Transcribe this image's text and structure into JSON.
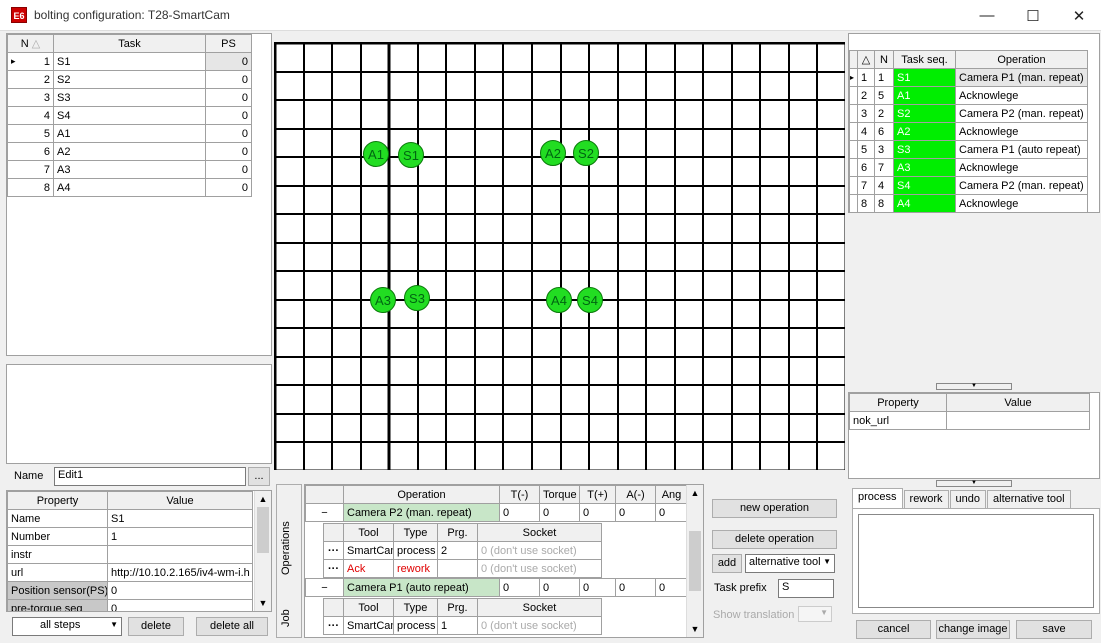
{
  "window": {
    "title": "bolting configuration:  T28-SmartCam",
    "icon_text": "E6"
  },
  "colors": {
    "green": "#00ee00",
    "dot": "#22dd22",
    "grid": "#000000"
  },
  "task_table": {
    "headers": [
      "N",
      "Task",
      "PS"
    ],
    "rows": [
      {
        "n": "1",
        "task": "S1",
        "ps": "0"
      },
      {
        "n": "2",
        "task": "S2",
        "ps": "0"
      },
      {
        "n": "3",
        "task": "S3",
        "ps": "0"
      },
      {
        "n": "4",
        "task": "S4",
        "ps": "0"
      },
      {
        "n": "5",
        "task": "A1",
        "ps": "0"
      },
      {
        "n": "6",
        "task": "A2",
        "ps": "0"
      },
      {
        "n": "7",
        "task": "A3",
        "ps": "0"
      },
      {
        "n": "8",
        "task": "A4",
        "ps": "0"
      }
    ]
  },
  "name_field": {
    "label": "Name",
    "value": "Edit1",
    "dots": "..."
  },
  "props_left": {
    "headers": [
      "Property",
      "Value"
    ],
    "rows": [
      {
        "p": "Name",
        "v": "S1"
      },
      {
        "p": "Number",
        "v": "1"
      },
      {
        "p": "instr",
        "v": ""
      },
      {
        "p": "url",
        "v": "http://10.10.2.165/iv4-wm-i.h"
      },
      {
        "p": "Position sensor(PS)",
        "v": "0"
      },
      {
        "p": "pre-torque seq",
        "v": "0"
      }
    ]
  },
  "bottom_left": {
    "steps_select": "all steps",
    "delete": "delete",
    "delete_all": "delete all"
  },
  "canvas": {
    "dots": [
      "A1",
      "S1",
      "A2",
      "S2",
      "A3",
      "S3",
      "A4",
      "S4"
    ]
  },
  "seq_table": {
    "headers": [
      "",
      "N",
      "Task seq.",
      "Operation"
    ],
    "rows": [
      {
        "i": "1",
        "n": "1",
        "t": "S1",
        "op": "Camera P1 (man. repeat)"
      },
      {
        "i": "2",
        "n": "5",
        "t": "A1",
        "op": "Acknowlege"
      },
      {
        "i": "3",
        "n": "2",
        "t": "S2",
        "op": "Camera P2 (man. repeat)"
      },
      {
        "i": "4",
        "n": "6",
        "t": "A2",
        "op": "Acknowlege"
      },
      {
        "i": "5",
        "n": "3",
        "t": "S3",
        "op": "Camera P1 (auto repeat)"
      },
      {
        "i": "6",
        "n": "7",
        "t": "A3",
        "op": "Acknowlege"
      },
      {
        "i": "7",
        "n": "4",
        "t": "S4",
        "op": "Camera P2 (man. repeat)"
      },
      {
        "i": "8",
        "n": "8",
        "t": "A4",
        "op": "Acknowlege"
      }
    ]
  },
  "props_right": {
    "headers": [
      "Property",
      "Value"
    ],
    "rows": [
      {
        "p": "nok_url",
        "v": ""
      }
    ]
  },
  "right_tabs": [
    "process",
    "rework",
    "undo",
    "alternative tool"
  ],
  "ops": {
    "side_tabs": [
      "Operations",
      "Job"
    ],
    "headers": [
      "Operation",
      "T(-)",
      "Torque",
      "T(+)",
      "A(-)",
      "Ang"
    ],
    "op1": {
      "name": "Camera P2 (man. repeat)",
      "vals": [
        "0",
        "0",
        "0",
        "0",
        "0"
      ],
      "tool_headers": [
        "Tool",
        "Type",
        "Prg.",
        "Socket"
      ],
      "tools": [
        {
          "tool": "SmartCam",
          "type": "process",
          "prg": "2",
          "socket": "0 (don't use socket)"
        },
        {
          "tool": "Ack",
          "type": "rework",
          "prg": "",
          "socket": "0 (don't use socket)"
        }
      ]
    },
    "op2": {
      "name": "Camera P1 (auto repeat)",
      "vals": [
        "0",
        "0",
        "0",
        "0",
        "0"
      ],
      "tool_headers": [
        "Tool",
        "Type",
        "Prg.",
        "Socket"
      ],
      "tools": [
        {
          "tool": "SmartCam",
          "type": "process",
          "prg": "1",
          "socket": "0 (don't use socket)"
        }
      ]
    }
  },
  "ops_actions": {
    "new": "new operation",
    "delete": "delete operation",
    "add": "add",
    "alt": "alternative tool",
    "prefix_label": "Task prefix",
    "prefix_value": "S",
    "show_translation": "Show translation"
  },
  "footer": {
    "cancel": "cancel",
    "change_image": "change image",
    "save": "save"
  },
  "glyphs": {
    "minus": "−",
    "dots": "···",
    "sort": "△",
    "arrow_up": "▲",
    "arrow_down": "▼",
    "caret": "▼",
    "pointer": "▸",
    "min": "—",
    "max": "☐",
    "close": "✕"
  }
}
